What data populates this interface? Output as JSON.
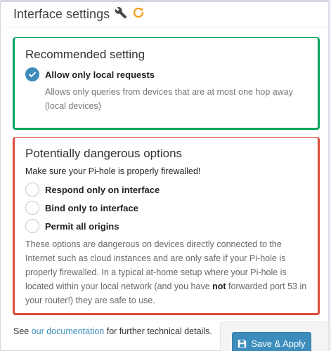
{
  "header": {
    "title": "Interface settings",
    "icons": [
      "wrench-icon",
      "refresh-icon"
    ]
  },
  "recommended": {
    "title": "Recommended setting",
    "option": {
      "label": "Allow only local requests",
      "checked": true
    },
    "help_line1": "Allows only queries from devices that are at most one hop away",
    "help_line2": "(local devices)"
  },
  "dangerous": {
    "title": "Potentially dangerous options",
    "warning": "Make sure your Pi-hole is properly firewalled!",
    "options": [
      {
        "label": "Respond only on interface",
        "checked": false
      },
      {
        "label": "Bind only to interface",
        "checked": false
      },
      {
        "label": "Permit all origins",
        "checked": false
      }
    ],
    "help_line1": "These options are dangerous on devices directly connected to the",
    "help_line2": "Internet such as cloud instances and are only safe if your Pi-hole is",
    "help_line3": "properly firewalled. In a typical at-home setup where your Pi-hole is",
    "help_line4": "located within your local network (and you have ",
    "help_bold": "not",
    "help_line4_end": " forwarded port 53 in",
    "help_line5": "your router!) they are safe to use."
  },
  "footer": {
    "prefix": "See ",
    "link": "our documentation",
    "suffix": " for further technical details.",
    "save_label": "Save & Apply"
  },
  "colors": {
    "accent": "#3c8dbc",
    "success": "#00a65a",
    "danger": "#dd4b39",
    "refresh": "#f39c12"
  }
}
